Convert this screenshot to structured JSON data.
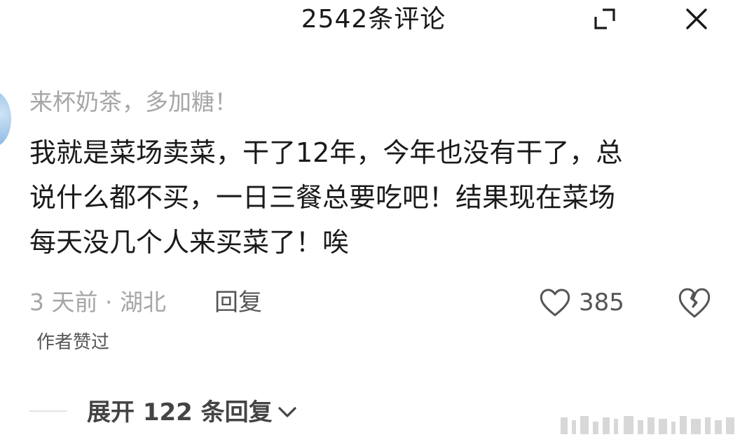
{
  "header": {
    "title": "2542条评论",
    "expand_icon": "expand-icon",
    "close_icon": "close-icon"
  },
  "comment": {
    "avatar_icon": "avatar",
    "username": "来杯奶茶，多加糖！",
    "lines": [
      "我就是菜场卖菜，干了12年，今年也没有干了，总",
      "说什么都不买，一日三餐总要吃吧！结果现在菜场",
      "每天没几个人来买菜了！唉"
    ],
    "meta": "3 天前 · 湖北",
    "reply_label": "回复",
    "like_icon": "heart-icon",
    "like_count": "385",
    "dislike_icon": "broken-heart-icon",
    "author_liked": "作者赞过",
    "expand_replies_label": "展开 122 条回复",
    "expand_chevron_icon": "chevron-down-icon"
  },
  "colors": {
    "text_primary": "#1a1a1a",
    "text_secondary": "#a6a6a6",
    "text_muted": "#555555",
    "background": "#ffffff"
  }
}
